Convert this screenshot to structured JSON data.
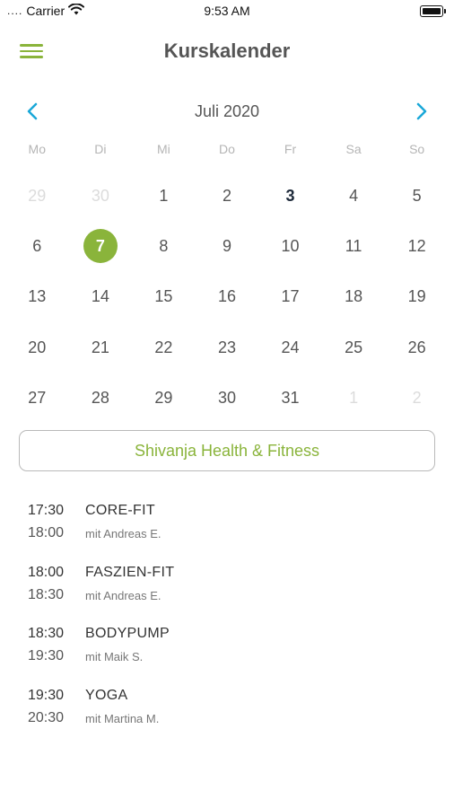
{
  "status_bar": {
    "dots": "....",
    "carrier": "Carrier",
    "time": "9:53 AM"
  },
  "header": {
    "title": "Kurskalender",
    "menu_icon": "hamburger-menu-icon"
  },
  "calendar": {
    "month_label": "Juli 2020",
    "prev_icon": "chevron-left-icon",
    "next_icon": "chevron-right-icon",
    "weekdays": [
      "Mo",
      "Di",
      "Mi",
      "Do",
      "Fr",
      "Sa",
      "So"
    ],
    "weeks": [
      [
        "29",
        "30",
        "1",
        "2",
        "3",
        "4",
        "5"
      ],
      [
        "6",
        "7",
        "8",
        "9",
        "10",
        "11",
        "12"
      ],
      [
        "13",
        "14",
        "15",
        "16",
        "17",
        "18",
        "19"
      ],
      [
        "20",
        "21",
        "22",
        "23",
        "24",
        "25",
        "26"
      ],
      [
        "27",
        "28",
        "29",
        "30",
        "31",
        "1",
        "2"
      ]
    ],
    "today": "3",
    "selected": "7",
    "accent_color": "#8ab43b"
  },
  "studio": {
    "label": "Shivanja Health & Fitness"
  },
  "classes": [
    {
      "start": "17:30",
      "end": "18:00",
      "name": "CORE-FIT",
      "trainer": "mit Andreas E."
    },
    {
      "start": "18:00",
      "end": "18:30",
      "name": "FASZIEN-FIT",
      "trainer": "mit Andreas E."
    },
    {
      "start": "18:30",
      "end": "19:30",
      "name": "BODYPUMP",
      "trainer": "mit Maik S."
    },
    {
      "start": "19:30",
      "end": "20:30",
      "name": "YOGA",
      "trainer": "mit Martina M."
    }
  ]
}
